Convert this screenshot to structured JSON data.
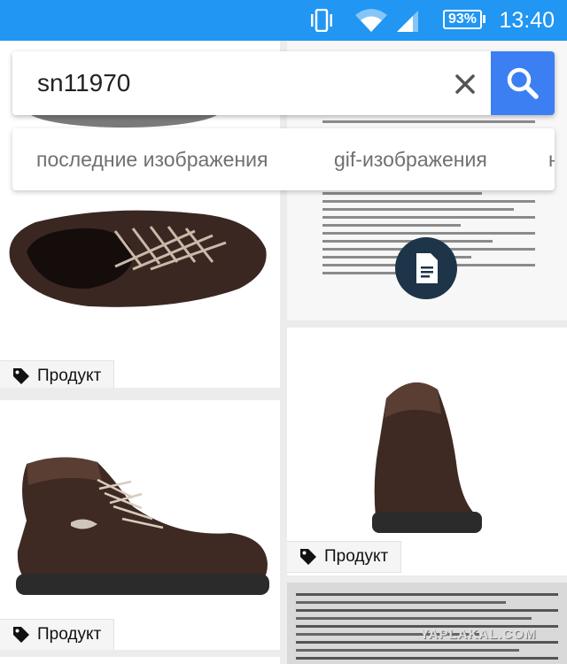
{
  "status_bar": {
    "battery": "93%",
    "time": "13:40",
    "icons": [
      "vibrate-icon",
      "wifi-icon",
      "signal-icon",
      "battery-icon"
    ],
    "background": "#2196f3"
  },
  "search": {
    "query": "sn11970",
    "clear_icon": "close-icon",
    "submit_icon": "search-icon",
    "accent": "#3b7ff2"
  },
  "chips": [
    "последние изображения",
    "gif-изображения",
    "н"
  ],
  "results": [
    {
      "kind": "image",
      "badge": "Продукт"
    },
    {
      "kind": "document",
      "icon": "document-icon"
    },
    {
      "kind": "image",
      "badge": "Продукт"
    },
    {
      "kind": "image",
      "badge": "Продукт"
    },
    {
      "kind": "document"
    }
  ],
  "watermark": "YAPLAKAL.COM"
}
